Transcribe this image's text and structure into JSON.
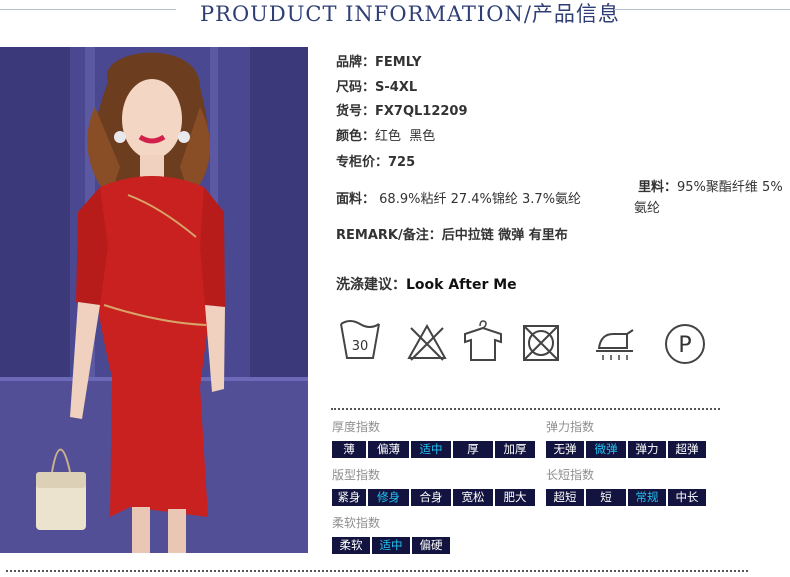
{
  "header": {
    "title": "PROUDUCT INFORMATION/产品信息"
  },
  "photo": {
    "alt": "red dress model photo"
  },
  "specs": {
    "brand_label": "品牌：",
    "brand": "FEMLY",
    "size_label": "尺码：",
    "size": "S-4XL",
    "sku_label": "货号：",
    "sku": "FX7QL12209",
    "color_label": "颜色：",
    "color": "红色  黑色",
    "price_label": "专柜价：",
    "price": "725",
    "fabric_label": "面料：",
    "fabric": "68.9%粘纤 27.4%锦纶 3.7%氨纶",
    "lining_label": "里料：",
    "lining_line1": "95%聚酯纤维 5%",
    "lining_line2": "氨纶",
    "remark_label": "REMARK/备注：",
    "remark": "后中拉链 微弹 有里布",
    "wash_label": "洗涤建议：",
    "wash": "Look After Me"
  },
  "care_icons": [
    {
      "name": "wash-30-icon",
      "text": "30"
    },
    {
      "name": "no-bleach-icon"
    },
    {
      "name": "hang-dry-icon"
    },
    {
      "name": "no-tumble-dry-icon"
    },
    {
      "name": "iron-steam-icon"
    },
    {
      "name": "dry-clean-p-icon",
      "text": "P"
    }
  ],
  "indices": {
    "thickness": {
      "label": "厚度指数",
      "options": [
        "薄",
        "偏薄",
        "适中",
        "厚",
        "加厚"
      ],
      "selected": "适中"
    },
    "elasticity": {
      "label": "弹力指数",
      "options": [
        "无弹",
        "微弹",
        "弹力",
        "超弹"
      ],
      "selected": "微弹"
    },
    "fit": {
      "label": "版型指数",
      "options": [
        "紧身",
        "修身",
        "合身",
        "宽松",
        "肥大"
      ],
      "selected": "修身"
    },
    "length": {
      "label": "长短指数",
      "options": [
        "超短",
        "短",
        "常规",
        "中长"
      ],
      "selected": "常规"
    },
    "softness": {
      "label": "柔软指数",
      "options": [
        "柔软",
        "适中",
        "偏硬"
      ],
      "selected": "适中"
    }
  },
  "colors": {
    "accent_selected": "#23c2f2",
    "chip_bg": "#12133f",
    "title": "#2f3f75",
    "dress_red": "#c8211f"
  }
}
